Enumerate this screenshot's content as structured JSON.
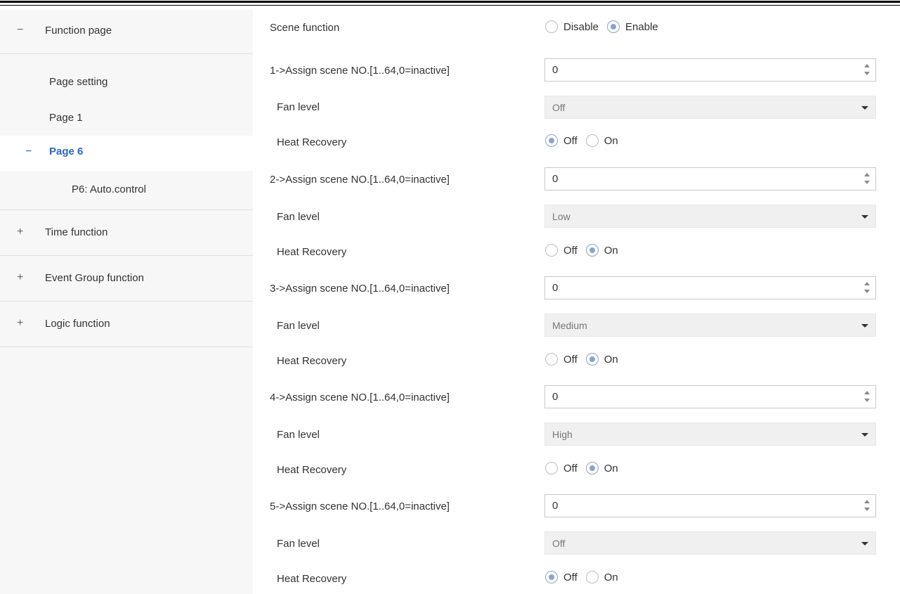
{
  "sidebar": {
    "function_page": {
      "sign": "−",
      "label": "Function page"
    },
    "page_setting": {
      "label": "Page setting"
    },
    "page_1": {
      "label": "Page 1"
    },
    "page_6": {
      "sign": "−",
      "label": "Page 6"
    },
    "p6_auto": {
      "label": "P6: Auto.control"
    },
    "time_function": {
      "sign": "+",
      "label": "Time function"
    },
    "event_group": {
      "sign": "+",
      "label": "Event Group function"
    },
    "logic_function": {
      "sign": "+",
      "label": "Logic function"
    }
  },
  "scene_function": {
    "label": "Scene function",
    "options": [
      "Disable",
      "Enable"
    ],
    "selected": "Enable"
  },
  "scenes": [
    {
      "assign_label": "1->Assign scene NO.[1..64,0=inactive]",
      "assign_value": "0",
      "fan_label": "Fan level",
      "fan_value": "Off",
      "heat_label": "Heat Recovery",
      "heat_off": "Off",
      "heat_on": "On",
      "heat_selected": "Off"
    },
    {
      "assign_label": "2->Assign scene NO.[1..64,0=inactive]",
      "assign_value": "0",
      "fan_label": "Fan level",
      "fan_value": "Low",
      "heat_label": "Heat Recovery",
      "heat_off": "Off",
      "heat_on": "On",
      "heat_selected": "On"
    },
    {
      "assign_label": "3->Assign scene NO.[1..64,0=inactive]",
      "assign_value": "0",
      "fan_label": "Fan level",
      "fan_value": "Medium",
      "heat_label": "Heat Recovery",
      "heat_off": "Off",
      "heat_on": "On",
      "heat_selected": "On"
    },
    {
      "assign_label": "4->Assign scene NO.[1..64,0=inactive]",
      "assign_value": "0",
      "fan_label": "Fan level",
      "fan_value": "High",
      "heat_label": "Heat Recovery",
      "heat_off": "Off",
      "heat_on": "On",
      "heat_selected": "On"
    },
    {
      "assign_label": "5->Assign scene NO.[1..64,0=inactive]",
      "assign_value": "0",
      "fan_label": "Fan level",
      "fan_value": "Off",
      "heat_label": "Heat Recovery",
      "heat_off": "Off",
      "heat_on": "On",
      "heat_selected": "Off"
    }
  ]
}
